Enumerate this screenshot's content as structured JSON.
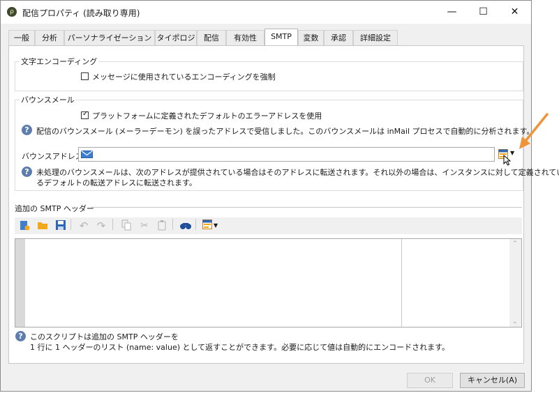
{
  "window": {
    "title": "配信プロパティ (読み取り専用)",
    "app_icon_glyph": "ρ",
    "minimize_glyph": "—",
    "maximize_glyph": "☐",
    "close_glyph": "✕"
  },
  "tabs": [
    {
      "label": "一般"
    },
    {
      "label": "分析"
    },
    {
      "label": "パーソナライゼーション"
    },
    {
      "label": "タイポロジ"
    },
    {
      "label": "配信"
    },
    {
      "label": "有効性"
    },
    {
      "label": "SMTP"
    },
    {
      "label": "変数"
    },
    {
      "label": "承認"
    },
    {
      "label": "詳細設定"
    }
  ],
  "active_tab": "SMTP",
  "encoding": {
    "legend": "文字エンコーディング",
    "force_label": "メッセージに使用されているエンコーディングを強制",
    "force_checked": false
  },
  "bounce": {
    "legend": "バウンスメール",
    "use_default_label": "プラットフォームに定義されたデフォルトのエラーアドレスを使用",
    "use_default_checked": true,
    "help1": "配信のバウンスメール (メーラーデーモン) を誤ったアドレスで受信しました。このバウンスメールは inMail プロセスで自動的に分析されます。",
    "address_label": "バウンスアドレス:",
    "address_value": "",
    "help2_line1": "未処理のバウンスメールは、次のアドレスが提供されている場合はそのアドレスに転送されます。それ以外の場合は、インスタンスに対して定義されてい",
    "help2_line2": "るデフォルトの転送アドレスに転送されます。"
  },
  "smtp_headers": {
    "legend": "追加の SMTP ヘッダー",
    "help_line1": "このスクリプトは追加の SMTP ヘッダーを",
    "help_line2": "1 行に 1 ヘッダーのリスト (name: value) として返すことができます。必要に応じて値は自動的にエンコードされます。"
  },
  "toolbar_icons": [
    "new-script-icon",
    "open-folder-icon",
    "save-icon",
    "undo-icon",
    "redo-icon",
    "copy-icon",
    "cut-icon",
    "paste-icon",
    "find-icon",
    "insert-field-icon"
  ],
  "buttons": {
    "ok": "OK",
    "cancel": "キャンセル(A)"
  },
  "colors": {
    "accent_arrow": "#f0943a",
    "help_icon": "#5d7daf",
    "folder_icon": "#f2a81d",
    "save_icon": "#2f66b3"
  }
}
